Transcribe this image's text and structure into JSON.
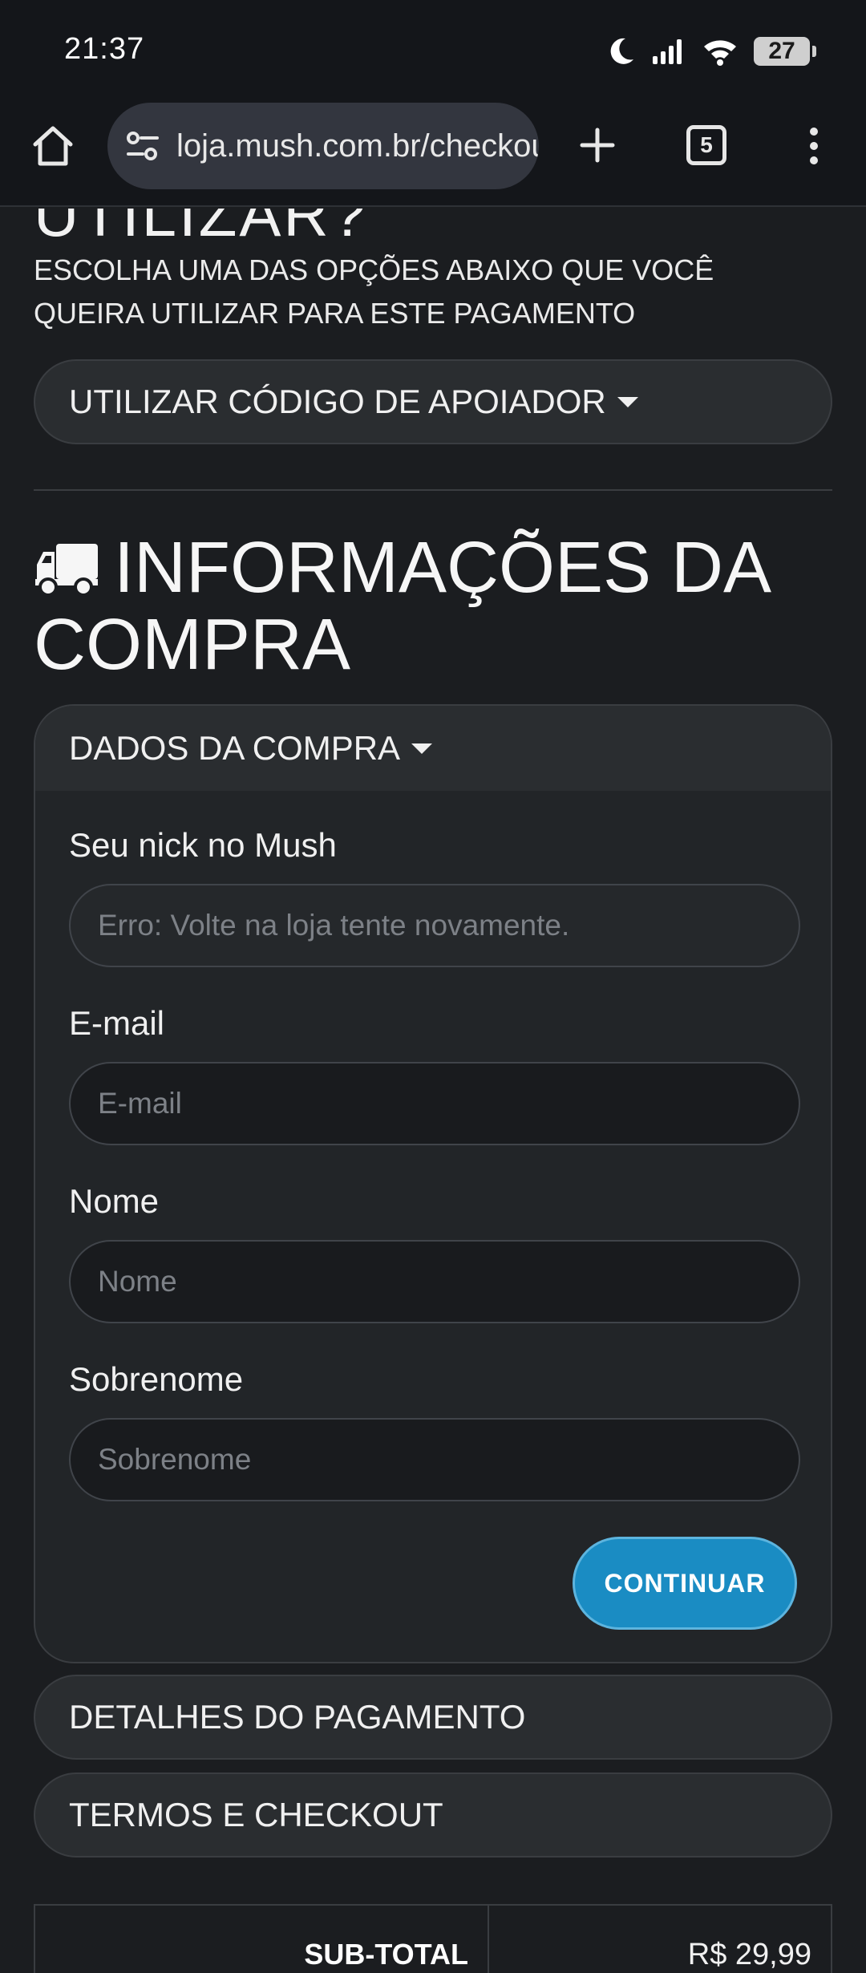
{
  "status_bar": {
    "time": "21:37",
    "battery": "27"
  },
  "browser": {
    "url": "loja.mush.com.br/checkout",
    "tab_count": "5"
  },
  "voucher": {
    "heading_fragment": "UTILIZAR?",
    "instructions": "ESCOLHA UMA DAS OPÇÕES ABAIXO QUE VOCÊ QUEIRA UTILIZAR PARA ESTE PAGAMENTO",
    "supporter_code_label": "UTILIZAR CÓDIGO DE APOIADOR"
  },
  "purchase_info": {
    "title": "INFORMAÇÕES DA COMPRA",
    "card_header": "DADOS DA COMPRA",
    "fields": [
      {
        "label": "Seu nick no Mush",
        "placeholder": "Erro: Volte na loja tente novamente."
      },
      {
        "label": "E-mail",
        "placeholder": "E-mail"
      },
      {
        "label": "Nome",
        "placeholder": "Nome"
      },
      {
        "label": "Sobrenome",
        "placeholder": "Sobrenome"
      }
    ],
    "continue_label": "CONTINUAR"
  },
  "sections": {
    "payment_details": "DETALHES DO PAGAMENTO",
    "terms_checkout": "TERMOS E CHECKOUT"
  },
  "summary": {
    "subtotal_label": "SUB-TOTAL",
    "subtotal_value": "R$ 29,99"
  },
  "colors": {
    "background": "#1b1d20",
    "card": "#222528",
    "accent_button": "#1a8cc3"
  }
}
